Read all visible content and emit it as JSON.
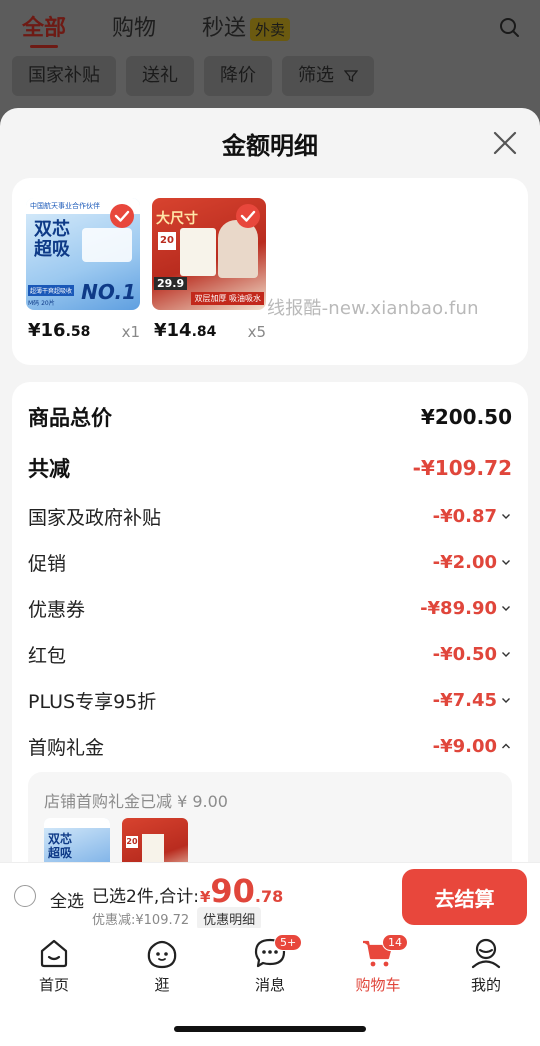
{
  "bg": {
    "tabs": [
      "全部",
      "购物",
      "秒送"
    ],
    "waimai_badge": "外卖",
    "chips": [
      "国家补贴",
      "送礼",
      "降价",
      "筛选"
    ]
  },
  "sheet": {
    "title": "金额明细",
    "products": [
      {
        "price_int": "¥16",
        "price_dec": ".58",
        "qty": "x1",
        "img_lines": [
          "中国航天事业合作伙伴",
          "双芯",
          "超吸",
          "NO.1",
          "超薄干爽超吸收",
          "M码 20片"
        ]
      },
      {
        "price_int": "¥14",
        "price_dec": ".84",
        "qty": "x5",
        "img_lines": [
          "大尺寸",
          "20",
          "29.9",
          "双层加厚 吸油吸水"
        ]
      }
    ],
    "watermark": "线报酷-new.xianbao.fun",
    "rows": [
      {
        "label": "商品总价",
        "value": "¥200.50",
        "big": true,
        "red": false,
        "chevron": ""
      },
      {
        "label": "共减",
        "value": "-¥109.72",
        "big": true,
        "red": true,
        "chevron": ""
      },
      {
        "label": "国家及政府补贴",
        "value": "-¥0.87",
        "big": false,
        "red": true,
        "chevron": "down"
      },
      {
        "label": "促销",
        "value": "-¥2.00",
        "big": false,
        "red": true,
        "chevron": "down"
      },
      {
        "label": "优惠券",
        "value": "-¥89.90",
        "big": false,
        "red": true,
        "chevron": "down"
      },
      {
        "label": "红包",
        "value": "-¥0.50",
        "big": false,
        "red": true,
        "chevron": "down"
      },
      {
        "label": "PLUS专享95折",
        "value": "-¥7.45",
        "big": false,
        "red": true,
        "chevron": "down"
      },
      {
        "label": "首购礼金",
        "value": "-¥9.00",
        "big": false,
        "red": true,
        "chevron": "up"
      }
    ],
    "gift_note": "店铺首购礼金已减 ¥ 9.00"
  },
  "checkout": {
    "select_all": "全选",
    "selected_text": "已选2件,合计:",
    "total_yen": "¥",
    "total_int": "90",
    "total_dec": ".78",
    "discount_text": "优惠减:¥109.72",
    "discount_btn": "优惠明细",
    "pay_btn": "去结算"
  },
  "tabbar": {
    "tabs": [
      {
        "label": "首页",
        "icon": "home-icon",
        "badge": ""
      },
      {
        "label": "逛",
        "icon": "face-icon",
        "badge": ""
      },
      {
        "label": "消息",
        "icon": "chat-icon",
        "badge": "5+"
      },
      {
        "label": "购物车",
        "icon": "cart-icon",
        "badge": "14"
      },
      {
        "label": "我的",
        "icon": "user-icon",
        "badge": ""
      }
    ]
  },
  "colors": {
    "accent": "#e8473c",
    "discount_red": "#e0463b"
  }
}
